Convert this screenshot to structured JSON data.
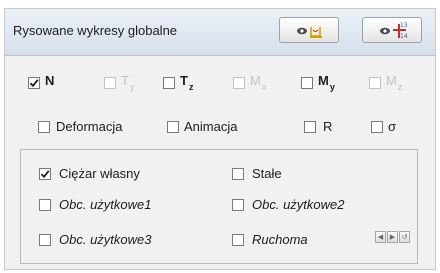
{
  "panel": {
    "title": "Rysowane wykresy globalne",
    "buttons": [
      {
        "icon": "eye-deformation-icon"
      },
      {
        "icon": "eye-numbering-icon",
        "icon_text_top": "13",
        "icon_text_bottom": "14"
      }
    ]
  },
  "forces_row": [
    {
      "symbol": "N",
      "sub": "",
      "checked": true,
      "enabled": true
    },
    {
      "symbol": "T",
      "sub": "y",
      "checked": false,
      "enabled": false
    },
    {
      "symbol": "T",
      "sub": "z",
      "checked": false,
      "enabled": true
    },
    {
      "symbol": "M",
      "sub": "x",
      "checked": false,
      "enabled": false
    },
    {
      "symbol": "M",
      "sub": "y",
      "checked": false,
      "enabled": true
    },
    {
      "symbol": "M",
      "sub": "z",
      "checked": false,
      "enabled": false
    }
  ],
  "display_row": [
    {
      "label": "Deformacja",
      "checked": false
    },
    {
      "label": "Animacja",
      "checked": false
    },
    {
      "label": "R",
      "checked": false
    },
    {
      "label": "σ",
      "checked": false
    }
  ],
  "load_cases": [
    {
      "label": "Ciężar własny",
      "checked": true,
      "italic": false
    },
    {
      "label": "Stałe",
      "checked": false,
      "italic": false
    },
    {
      "label": "Obc. użytkowe1",
      "checked": false,
      "italic": true
    },
    {
      "label": "Obc. użytkowe2",
      "checked": false,
      "italic": true
    },
    {
      "label": "Obc. użytkowe3",
      "checked": false,
      "italic": true
    },
    {
      "label": "Ruchoma",
      "checked": false,
      "italic": true
    }
  ],
  "nav_buttons": [
    {
      "icon": "prev-arrow-icon",
      "glyph": "◀"
    },
    {
      "icon": "next-arrow-icon",
      "glyph": "▶"
    },
    {
      "icon": "reset-icon",
      "glyph": "↺"
    }
  ],
  "colors": {
    "header_bg": "#dfe7f1",
    "panel_bg": "#f1f1f1",
    "disabled_text": "#c2c2c2",
    "numbering_red": "#c0302a",
    "numbering_blue": "#3358a8"
  }
}
